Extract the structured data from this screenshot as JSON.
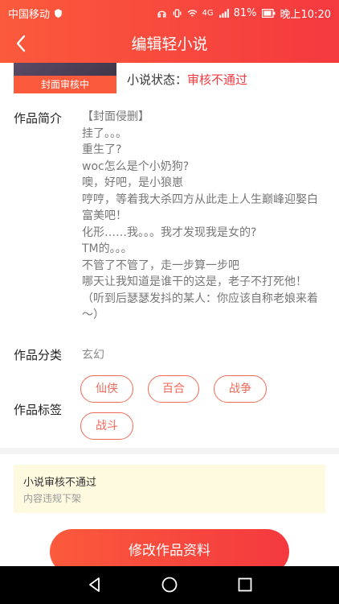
{
  "status_bar": {
    "carrier": "中国移动",
    "battery": "81%",
    "time": "晚上10:20",
    "network": "4G"
  },
  "nav": {
    "title": "编辑轻小说"
  },
  "cover": {
    "overlay_label": "封面审核中"
  },
  "status": {
    "label": "小说状态：",
    "value": "审核不通过"
  },
  "synopsis": {
    "label": "作品简介",
    "lines": [
      "【封面侵删】",
      "挂了。。。",
      "重生了?",
      "woc怎么是个小奶狗?",
      "噢，好吧，是小狼崽",
      "哼哼，等着我大杀四方从此走上人生巅峰迎娶白富美吧！",
      "化形……我。。。我才发现我是女的?",
      "TM的。。。",
      "不管了不管了，走一步算一步吧",
      "哪天让我知道是谁干的这是，老子不打死他！",
      "（听到后瑟瑟发抖的某人：你应该自称老娘来着～）"
    ]
  },
  "category": {
    "label": "作品分类",
    "value": "玄幻"
  },
  "tags": {
    "label": "作品标签",
    "items": [
      "仙侠",
      "百合",
      "战争",
      "战斗"
    ]
  },
  "notice": {
    "title": "小说审核不通过",
    "reason": "内容违规下架"
  },
  "actions": {
    "edit_label": "修改作品资料"
  },
  "colors": {
    "accent": "#f4393f",
    "tag_border": "#f06a5a",
    "notice_bg": "#fefae0"
  }
}
